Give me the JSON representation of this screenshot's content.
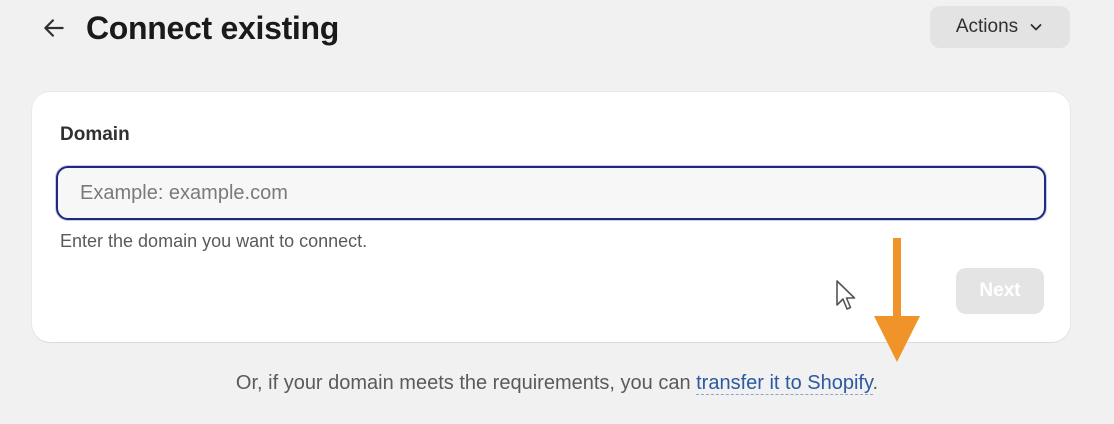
{
  "header": {
    "title": "Connect existing",
    "back_icon": "arrow-left-icon",
    "actions_label": "Actions",
    "actions_icon": "chevron-down-icon"
  },
  "form": {
    "field_label": "Domain",
    "input_value": "",
    "input_placeholder": "Example: example.com",
    "help_text": "Enter the domain you want to connect.",
    "next_label": "Next",
    "next_disabled": true
  },
  "footer": {
    "prefix": "Or, if your domain meets the requirements, you can ",
    "link_text": "transfer it to Shopify",
    "suffix": "."
  },
  "colors": {
    "page_background": "#f1f1f1",
    "card_background": "#ffffff",
    "input_focus_border": "#1f2a7a",
    "link": "#2c5aa0",
    "annotation_arrow": "#f0942a",
    "disabled_button": "#e4e4e4"
  }
}
